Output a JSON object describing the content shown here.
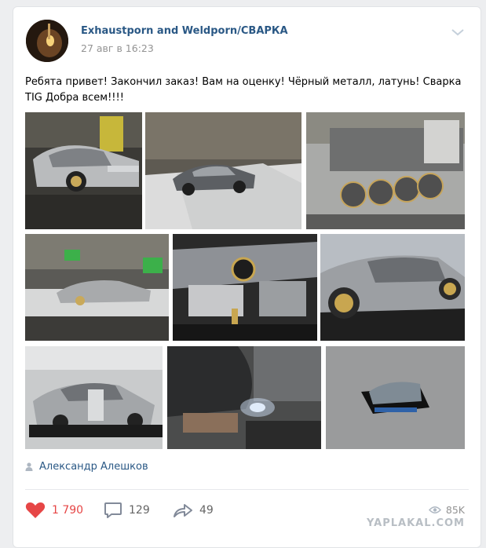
{
  "post": {
    "author": "Exhaustporn and Weldporn/СВАРКА",
    "date": "27 авг в 16:23",
    "text": "Ребята привет! Закончил заказ! Вам на оценку! Чёрный металл, латунь! Сварка TIG Добра всем!!!!",
    "signer": "Александр Алешков"
  },
  "actions": {
    "likes": "1 790",
    "comments": "129",
    "shares": "49",
    "views": "85K"
  },
  "watermark": "YAPLAKAL.COM",
  "icons": {
    "menu": "chevron-down-icon",
    "like": "heart-icon",
    "comment": "comment-icon",
    "share": "share-icon",
    "views": "eye-icon",
    "signer": "person-icon"
  },
  "colors": {
    "link": "#2a5885",
    "like": "#e64646",
    "muted": "#939393"
  }
}
